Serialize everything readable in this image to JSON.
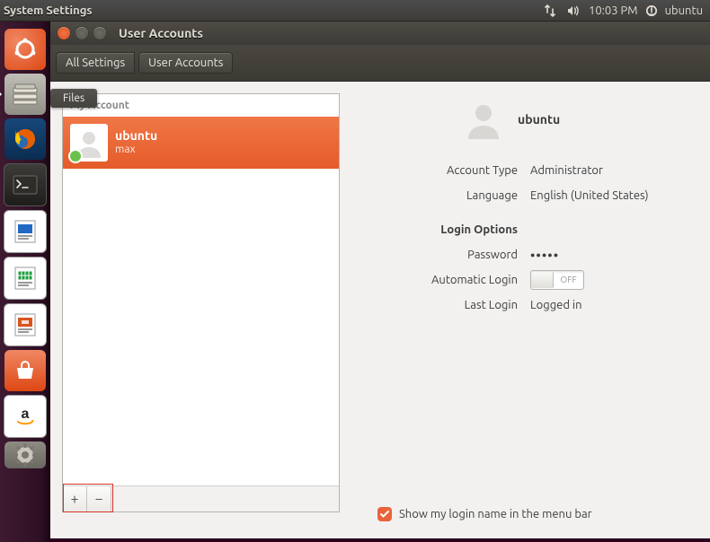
{
  "panel": {
    "app_name": "System Settings",
    "clock": "10:03 PM",
    "session_user": "ubuntu"
  },
  "tooltip": {
    "text": "Files"
  },
  "window": {
    "title": "User Accounts",
    "breadcrumbs": [
      "All Settings",
      "User Accounts"
    ]
  },
  "user_list": {
    "section": "My Account",
    "items": [
      {
        "display_name": "ubuntu",
        "username": "max",
        "selected": true
      }
    ],
    "add_label": "+",
    "remove_label": "−"
  },
  "detail": {
    "name": "ubuntu",
    "rows": {
      "account_type_label": "Account Type",
      "account_type": "Administrator",
      "language_label": "Language",
      "language": "English (United States)",
      "login_options": "Login Options",
      "password_label": "Password",
      "password_masked": "●●●●●",
      "auto_login_label": "Automatic Login",
      "auto_login_state": "OFF",
      "last_login_label": "Last Login",
      "last_login": "Logged in"
    },
    "checkbox_label": "Show my login name in the menu bar",
    "checkbox_checked": true
  },
  "launcher": {
    "items": [
      "dash",
      "files",
      "firefox",
      "terminal",
      "writer",
      "calc",
      "impress",
      "software-center",
      "amazon",
      "settings"
    ]
  }
}
